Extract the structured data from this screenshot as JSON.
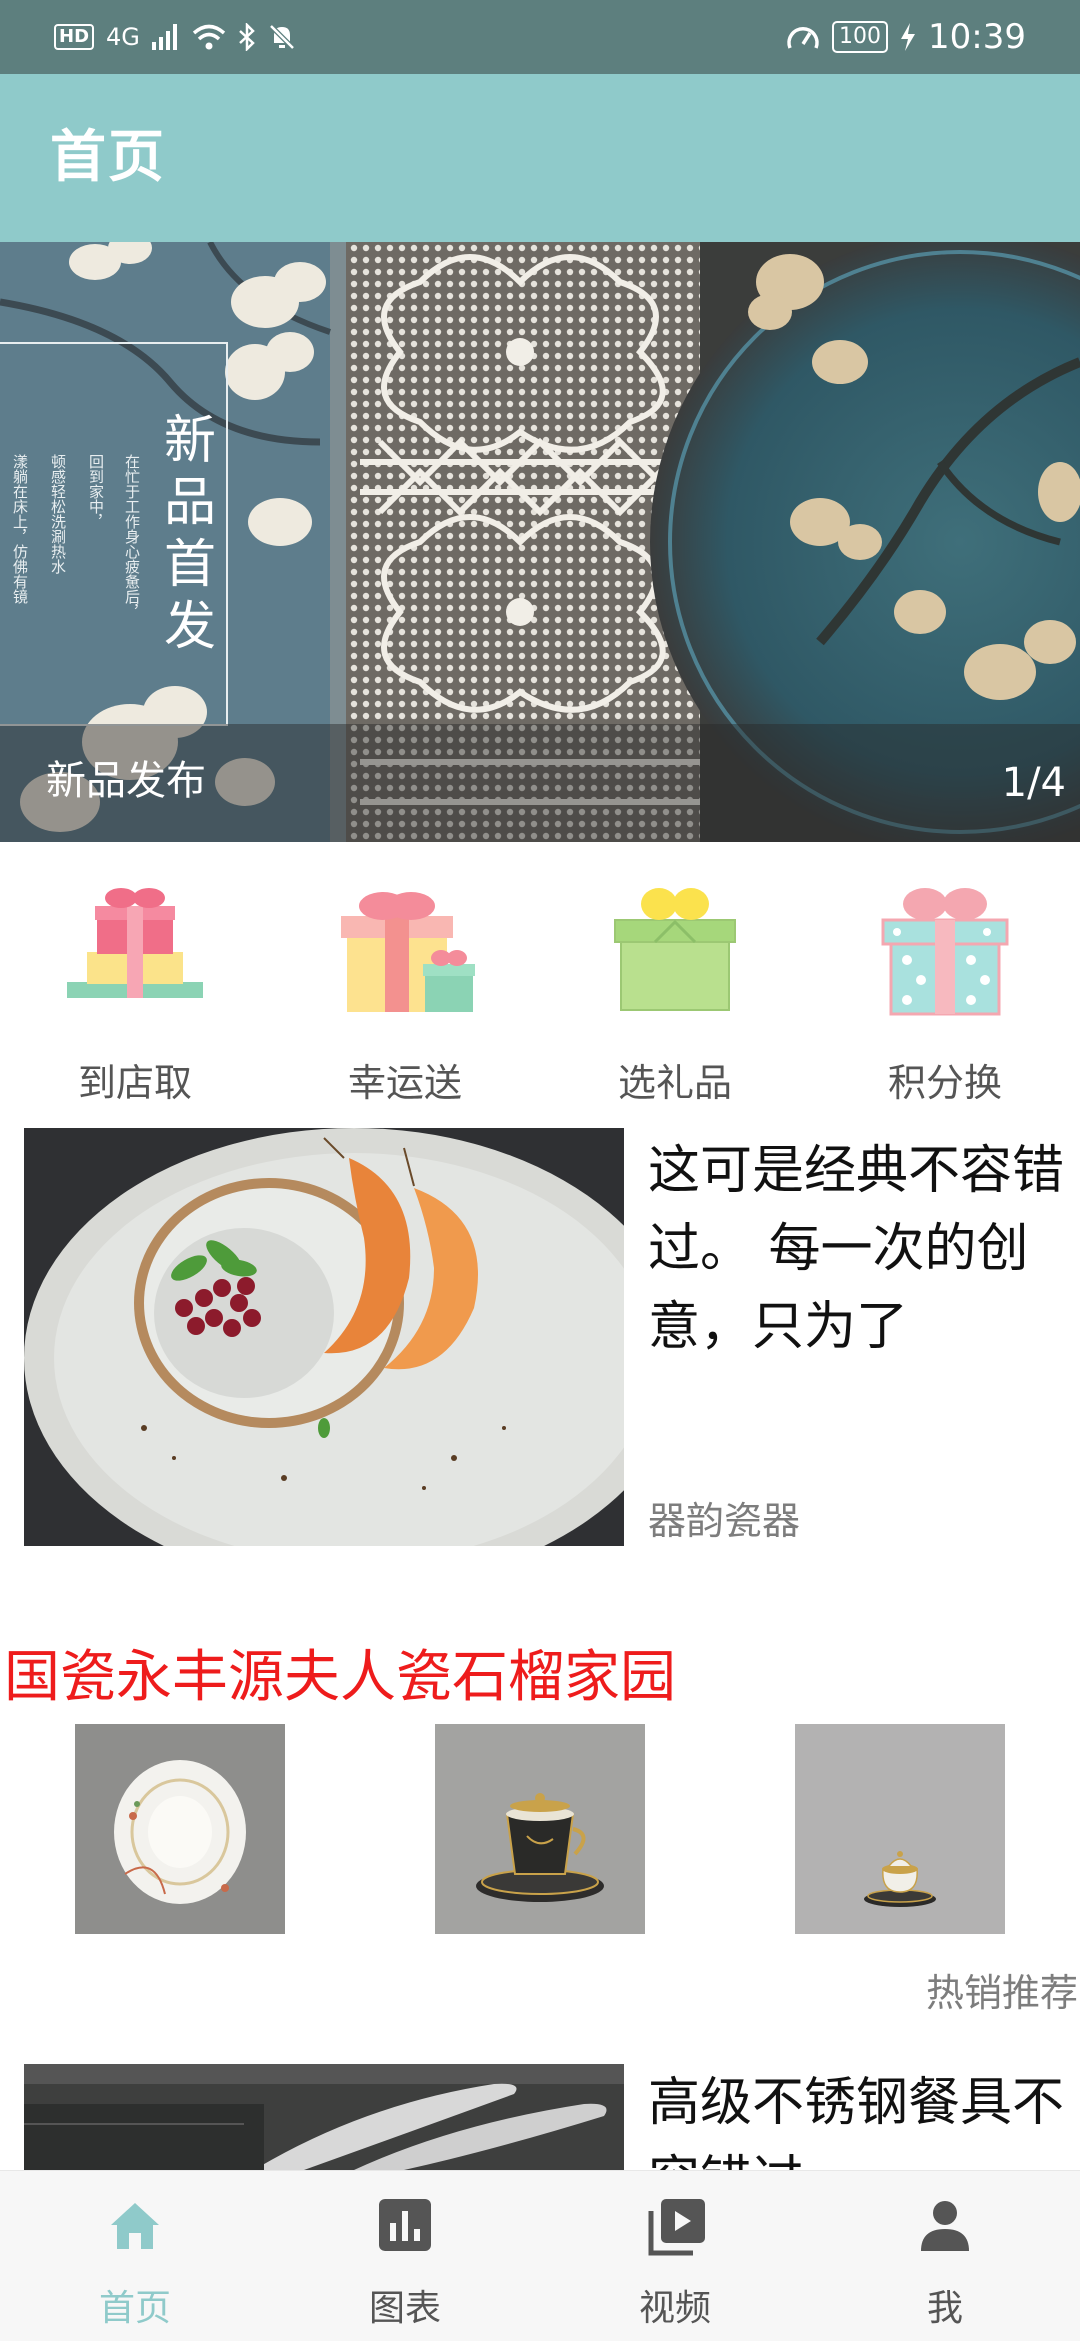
{
  "status_bar": {
    "hd": "HD",
    "network": "4G",
    "battery": "100",
    "time": "10:39",
    "icons": [
      "signal-icon",
      "wifi-icon",
      "bluetooth-icon",
      "mute-icon",
      "speed-icon",
      "charging-icon"
    ]
  },
  "app_bar": {
    "title": "首页",
    "color": "#8fcaca"
  },
  "banner": {
    "caption": "新品发布",
    "indicator": "1/4",
    "vertical_title": "新品首发"
  },
  "quick_menu": [
    {
      "label": "到店取",
      "icon": "gift-stack-icon"
    },
    {
      "label": "幸运送",
      "icon": "gift-box-icon"
    },
    {
      "label": "选礼品",
      "icon": "green-gift-icon"
    },
    {
      "label": "积分换",
      "icon": "polka-gift-icon"
    }
  ],
  "articles": [
    {
      "title": "这可是经典不容错过。 每一次的创意，只为了",
      "source": "器韵瓷器"
    },
    {
      "title": "高级不锈钢餐具不容错过"
    }
  ],
  "section": {
    "title": "国瓷永丰源夫人瓷石榴家园",
    "title_color": "#ee1c1c",
    "hot_label": "热销推荐"
  },
  "bottom_nav": [
    {
      "label": "首页",
      "icon": "home-icon",
      "active": true
    },
    {
      "label": "图表",
      "icon": "chart-icon",
      "active": false
    },
    {
      "label": "视频",
      "icon": "video-icon",
      "active": false
    },
    {
      "label": "我",
      "icon": "person-icon",
      "active": false
    }
  ]
}
